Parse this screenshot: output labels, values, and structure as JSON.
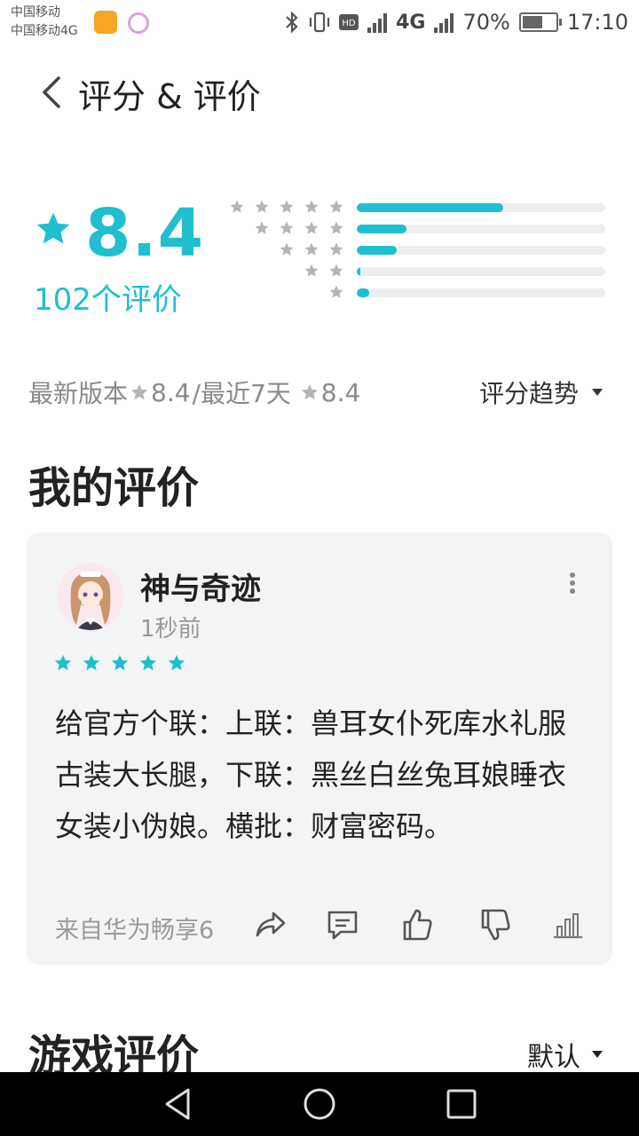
{
  "status_bar": {
    "carrier_1": "中国移动",
    "carrier_2": "中国移动4G",
    "network_1": "4G",
    "battery": "70%",
    "battery_level": 0.7,
    "time": "17:10"
  },
  "header": {
    "title": "评分 & 评价"
  },
  "rating": {
    "score": "8.4",
    "count_text": "102个评价",
    "distribution": [
      {
        "stars": 5,
        "fraction": 0.59
      },
      {
        "stars": 4,
        "fraction": 0.2
      },
      {
        "stars": 3,
        "fraction": 0.16
      },
      {
        "stars": 2,
        "fraction": 0.01
      },
      {
        "stars": 1,
        "fraction": 0.05
      }
    ]
  },
  "version_line": {
    "latest_label": "最新版本",
    "latest_score": "8.4",
    "separator": "/最近7天",
    "recent_score": "8.4",
    "trend_label": "评分趋势"
  },
  "my_review": {
    "section_title": "我的评价",
    "author": "神与奇迹",
    "time": "1秒前",
    "stars": 5,
    "text": "给官方个联：上联：兽耳女仆死库水礼服古装大长腿，下联：黑丝白丝兔耳娘睡衣女装小伪娘。横批：财富密码。",
    "source": "来自华为畅享6"
  },
  "game_reviews": {
    "section_title": "游戏评价",
    "sort_label": "默认"
  },
  "colors": {
    "accent": "#1fbfcf",
    "gray_star": "#b5b5b5",
    "card_bg": "#f3f4f6"
  },
  "icons": [
    "back-icon",
    "star-icon",
    "more-vert-icon",
    "share-icon",
    "comment-icon",
    "thumbs-up-icon",
    "thumbs-down-icon",
    "chart-icon",
    "triangle-down-icon",
    "nav-back-icon",
    "nav-home-icon",
    "nav-recent-icon"
  ]
}
